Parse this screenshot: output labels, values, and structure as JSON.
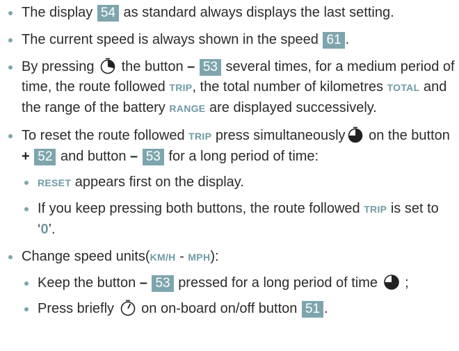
{
  "items": {
    "i1": {
      "t1": "The display",
      "b1": "54",
      "t2": "as standard always displays the last setting."
    },
    "i2": {
      "t1": "The current speed is always shown in the  speed",
      "b1": "61",
      "t2": "."
    },
    "i3": {
      "t1": "By pressing",
      "icon": "stopwatch-short-press-icon",
      "t2": "the button",
      "sign": "–",
      "b1": "53",
      "t3": "several times, for a medium period of time, the route followed",
      "kw1": "TRIP",
      "t4": ", the total number of kilometres",
      "kw2": "TOTAL",
      "t5": "and the range of the battery",
      "kw3": "RANGE",
      "t6": "are displayed successively."
    },
    "i4": {
      "t1": "To reset the route followed",
      "kw1": "TRIP",
      "t2": "press simultaneously",
      "icon": "stopwatch-long-press-icon",
      "t3": "on the button",
      "sign1": "+",
      "b1": "52",
      "t4": "and button",
      "sign2": "–",
      "b2": "53",
      "t5": "for a long period of time:",
      "sub1": {
        "kw1": "RESET",
        "t1": "appears first on the display."
      },
      "sub2": {
        "t1": "If you keep pressing both buttons, the route followed",
        "kw1": "TRIP",
        "t2": "is set to ‘",
        "zero": "0",
        "t3": "’."
      }
    },
    "i5": {
      "t1": "Change speed units(",
      "kw1": "KM/H",
      "t2": " - ",
      "kw2": "MPH",
      "t3": "):",
      "sub1": {
        "t1": "Keep the button",
        "sign": "–",
        "b1": "53",
        "t2": "pressed for a long period of time",
        "icon": "stopwatch-long-press-icon",
        "t3": ";"
      },
      "sub2": {
        "t1": "Press briefly",
        "icon": "stopwatch-brief-press-icon",
        "t2": "on on-board on/off button",
        "b1": "51",
        "t3": "."
      }
    }
  },
  "colors": {
    "badge": "#7ea5ad",
    "keyword": "#6f9aa4",
    "bullet": "#7fa4ad",
    "text": "#2b2b2b"
  }
}
